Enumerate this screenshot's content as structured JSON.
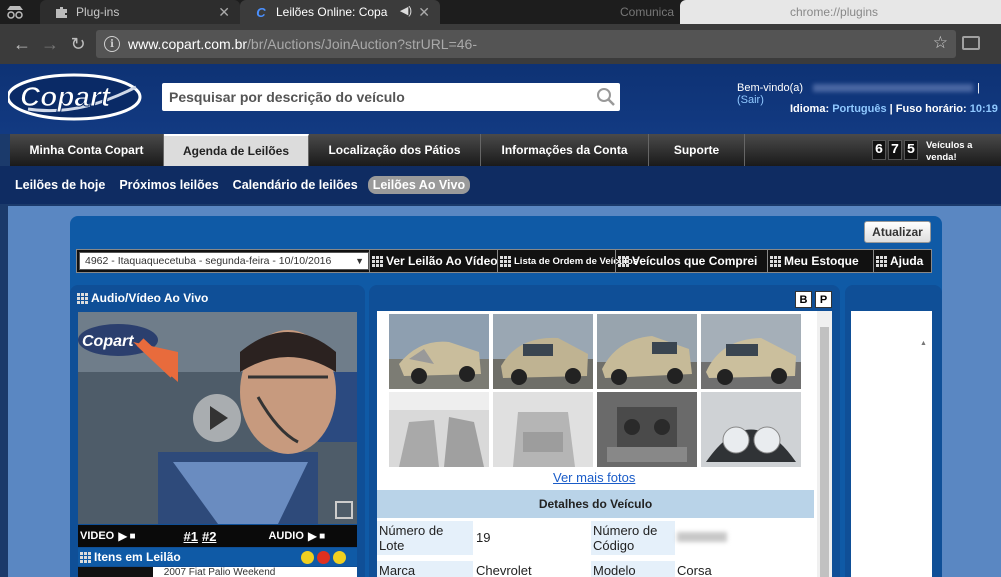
{
  "browser": {
    "tabs": [
      {
        "title": "Plug-ins"
      },
      {
        "title": "Leilões Online: Copa"
      },
      {
        "title": "Comunica"
      },
      {
        "title": "chrome://plugins"
      }
    ],
    "url_host": "www.copart.com.br",
    "url_path": "/br/Auctions/JoinAuction?strURL=46-"
  },
  "header": {
    "logo_text": "Copart",
    "search_placeholder": "Pesquisar por descrição do veículo",
    "welcome": "Bem-vindo(a)",
    "logout": "(Sair)",
    "lang_label": "Idioma:",
    "lang_value": "Português",
    "tz_label": "| Fuso horário:",
    "tz_value": "10:19"
  },
  "main_nav": {
    "items": [
      "Minha Conta Copart",
      "Agenda de Leilões",
      "Localização dos Pátios",
      "Informações da Conta",
      "Suporte"
    ],
    "vehicle_count_digits": [
      "6",
      "7",
      "5"
    ],
    "vehicle_label_line1": "Veículos a",
    "vehicle_label_line2": "venda!"
  },
  "sub_nav": {
    "items": [
      "Leilões de hoje",
      "Próximos leilões",
      "Calendário de leilões",
      "Leilões Ao Vivo"
    ]
  },
  "auction": {
    "refresh": "Atualizar",
    "selected_auction": "4962 - Itaquaquecetuba - segunda-feira - 10/10/2016",
    "toolbar": [
      "Ver Leilão Ao Vídeo",
      "Lista de Ordem de Veículos",
      "Veículos que Comprei",
      "Meu Estoque",
      "Ajuda"
    ],
    "av_title": "Audio/Vídeo Ao Vivo",
    "video_label": "VIDEO",
    "cam1": "#1",
    "cam2": "#2",
    "audio_label": "AUDIO",
    "items_title": "Itens em Leilão",
    "items_row": "2007 Fiat Palio Weekend",
    "btn_b": "B",
    "btn_p": "P",
    "more_photos": "Ver mais fotos",
    "details_title": "Detalhes do Veículo",
    "details": {
      "lot_label": "Número de Lote",
      "lot_value": "19",
      "code_label": "Número de Código",
      "make_label": "Marca",
      "make_value": "Chevrolet",
      "model_label": "Modelo",
      "model_value": "Corsa"
    }
  },
  "colors": {
    "header_blue": "#0e3274",
    "accent_link": "#8fc8ff",
    "panel_blue": "#0f4f97"
  }
}
